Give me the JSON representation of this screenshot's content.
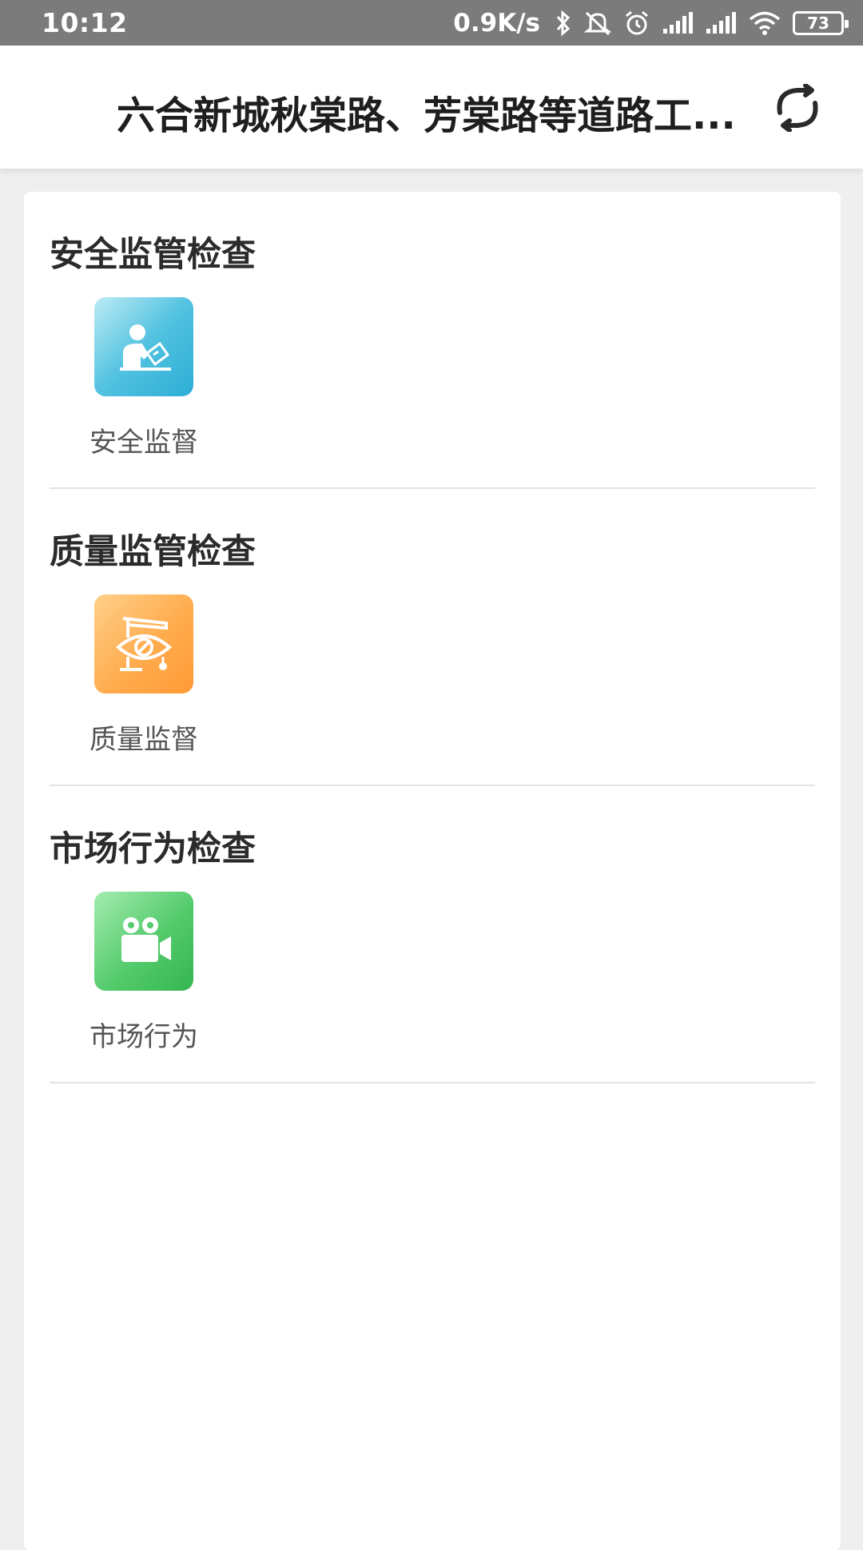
{
  "status_bar": {
    "time": "10:12",
    "net_speed": "0.9K/s",
    "battery": "73",
    "icons": [
      "bluetooth-icon",
      "mute-icon",
      "alarm-icon",
      "signal-icon",
      "signal-icon",
      "wifi-icon",
      "battery-icon"
    ]
  },
  "header": {
    "title": "六合新城秋棠路、芳棠路等道路工...",
    "refresh_icon": "refresh-icon"
  },
  "sections": [
    {
      "title": "安全监管检查",
      "item": {
        "label": "安全监督",
        "icon": "safety-inspector-icon",
        "color": "#4cc0df"
      }
    },
    {
      "title": "质量监管检查",
      "item": {
        "label": "质量监督",
        "icon": "quality-eye-icon",
        "color": "#ffab4d"
      }
    },
    {
      "title": "市场行为检查",
      "item": {
        "label": "市场行为",
        "icon": "video-camera-icon",
        "color": "#4fc868"
      }
    }
  ]
}
